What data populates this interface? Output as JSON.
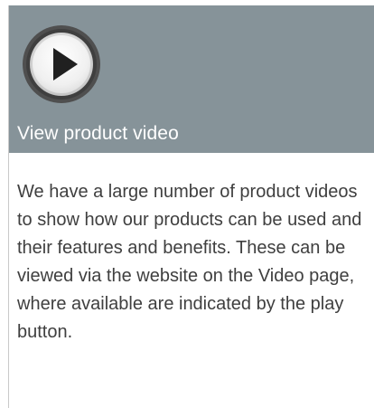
{
  "card": {
    "title": "View product video",
    "play_icon": "play-icon",
    "description": "We have a large number of product videos to show how our products can be used and their features and benefits. These can be viewed via the website on the Video page, where available are indicated by the play button."
  },
  "colors": {
    "header_background": "#869399",
    "title_text": "#ffffff",
    "body_text": "#3f3f3f"
  }
}
